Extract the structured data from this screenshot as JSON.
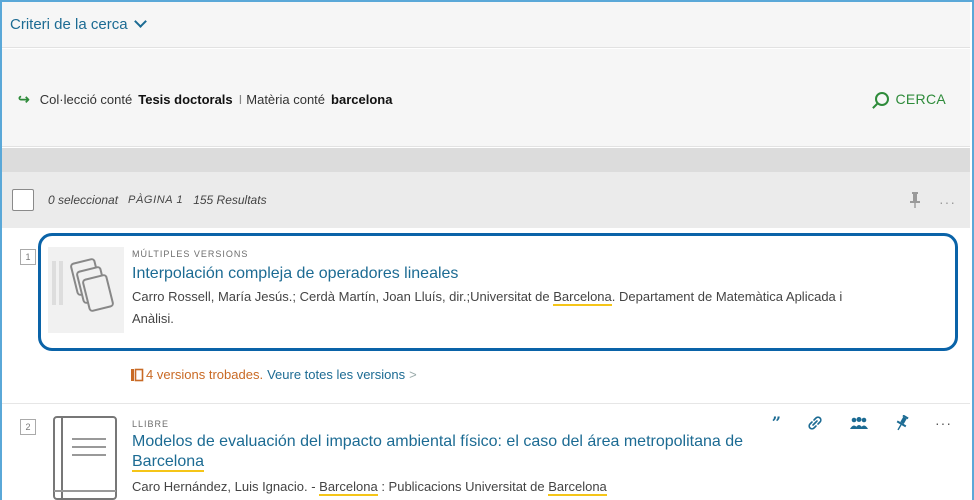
{
  "criteria": {
    "title": "Criteri de la cerca"
  },
  "query": {
    "field1_label": "Col·lecció conté",
    "field1_value": "Tesis doctorals",
    "separator": "I",
    "field2_label": "Matèria conté",
    "field2_value": "barcelona",
    "search_label": "CERCA"
  },
  "results_bar": {
    "selected_count": "0 seleccionat",
    "page_label": "PÀGINA 1",
    "results_count": "155 Resultats"
  },
  "results": [
    {
      "index": "1",
      "type": "MÚLTIPLES VERSIONS",
      "title": "Interpolación compleja de operadores lineales",
      "meta_pre": "Carro Rossell, María Jesús.; Cerdà Martín, Joan Lluís, dir.;Universitat de ",
      "meta_hl": "Barcelona",
      "meta_post": ". Departament de Matemàtica Aplicada i",
      "meta_line2": "Anàlisi.",
      "versions_text": "4 versions trobades.",
      "versions_link": "Veure totes les versions",
      "versions_arrow": ">"
    },
    {
      "index": "2",
      "type": "LLIBRE",
      "title_line1": "Modelos de evaluación del impacto ambiental físico: el caso del área metropolitana de",
      "title_line2": "Barcelona",
      "meta_a": "Caro Hernández, Luis Ignacio. - ",
      "meta_hl1": "Barcelona",
      "meta_b": " : Publicacions Universitat de ",
      "meta_hl2": "Barcelona"
    }
  ],
  "colors": {
    "accent": "#1c6b93",
    "green": "#2e8b3a",
    "highlight_border": "#0a63a8",
    "versions_orange": "#c96a25",
    "term_highlight": "#f5c518"
  }
}
